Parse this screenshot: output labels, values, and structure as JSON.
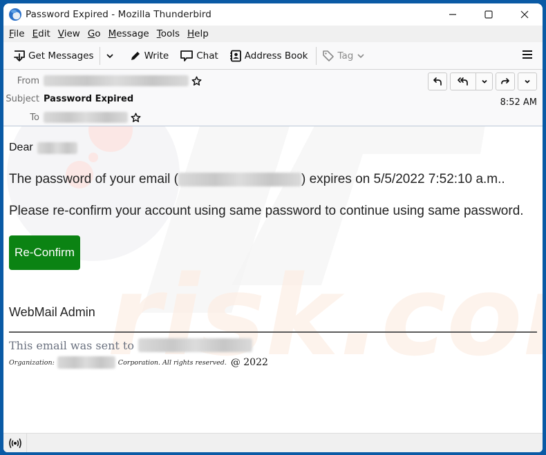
{
  "window": {
    "title": "Password Expired - Mozilla Thunderbird",
    "app_icon": "thunderbird-logo-icon",
    "controls": [
      "minimize-icon",
      "maximize-icon",
      "close-icon"
    ]
  },
  "menubar": {
    "items": [
      {
        "label_acc": "F",
        "label_rest": "ile"
      },
      {
        "label_acc": "E",
        "label_rest": "dit"
      },
      {
        "label_acc": "V",
        "label_rest": "iew"
      },
      {
        "label_acc": "G",
        "label_rest": "o"
      },
      {
        "label_acc": "M",
        "label_rest": "essage"
      },
      {
        "label_acc": "T",
        "label_rest": "ools"
      },
      {
        "label_acc": "H",
        "label_rest": "elp"
      }
    ]
  },
  "toolbar": {
    "get_messages": "Get Messages",
    "write": "Write",
    "chat": "Chat",
    "address_book": "Address Book",
    "tag": "Tag"
  },
  "header": {
    "from_label": "From",
    "subject_label": "Subject",
    "subject": "Password Expired",
    "to_label": "To",
    "time": "8:52 AM",
    "actions": [
      "reply",
      "reply-all",
      "reply-all-menu",
      "forward",
      "more"
    ]
  },
  "body": {
    "dear": "Dear",
    "line1_prefix": "The password of your email (",
    "line1_suffix": ") expires on 5/5/2022 7:52:10 a.m..",
    "line2": "Please re-confirm your account using same password to continue using same password.",
    "button_label": "Re-Confirm",
    "button_color": "#0b8313",
    "signature": "WebMail Admin",
    "footer_sent_to": "This email was sent to",
    "footer_org_label": "Organization:",
    "footer_rights": "Corporation. All rights reserved.",
    "footer_copy": "@ 2022"
  },
  "statusbar": {
    "icon": "online-status-icon"
  },
  "colors": {
    "frame": "#0a5aa5",
    "button_green": "#0b8313"
  }
}
